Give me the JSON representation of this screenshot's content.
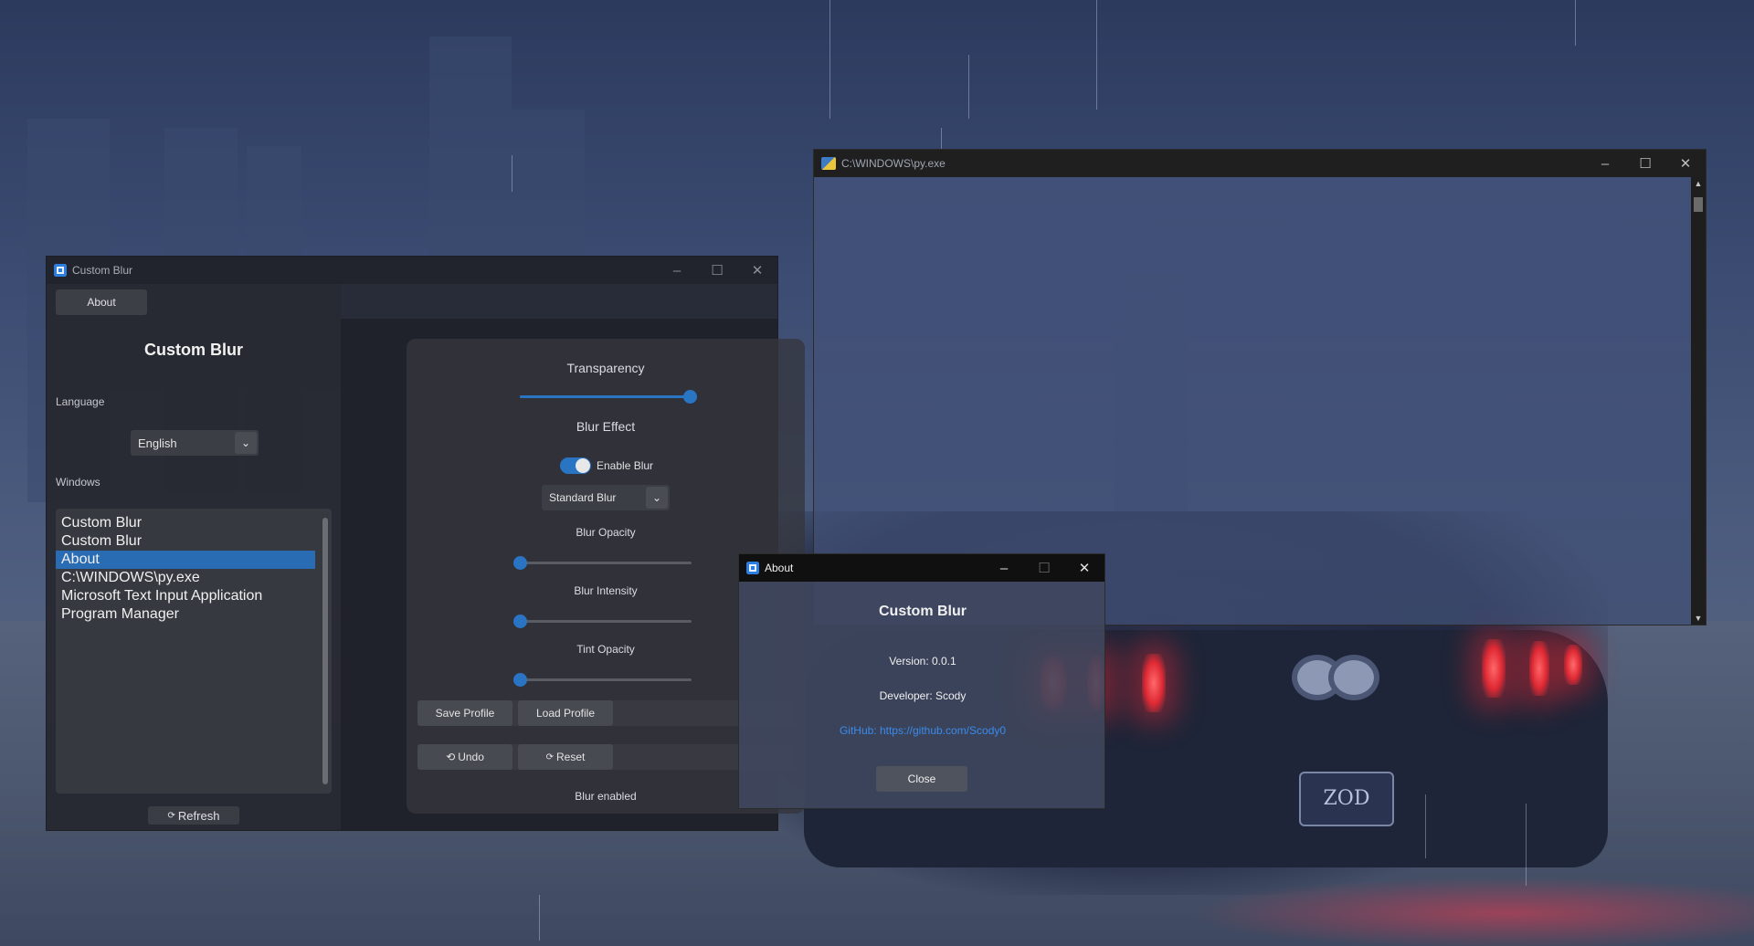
{
  "custom_blur_window": {
    "title": "Custom Blur",
    "about_button": "About",
    "heading": "Custom Blur",
    "language_label": "Language",
    "language_value": "English",
    "windows_label": "Windows",
    "windows_list": [
      "Custom Blur",
      "Custom Blur",
      "About",
      "C:\\WINDOWS\\py.exe",
      "Microsoft Text Input Application",
      "Program Manager"
    ],
    "selected_window_index": 2,
    "refresh_button": "Refresh",
    "transparency_label": "Transparency",
    "transparency_value": 1.0,
    "blur_effect_label": "Blur Effect",
    "enable_blur_label": "Enable Blur",
    "enable_blur_on": true,
    "blur_type": "Standard Blur",
    "blur_opacity_label": "Blur Opacity",
    "blur_opacity_value": 0.0,
    "blur_intensity_label": "Blur Intensity",
    "blur_intensity_value": 0.0,
    "tint_opacity_label": "Tint Opacity",
    "tint_opacity_value": 0.0,
    "save_profile": "Save Profile",
    "load_profile": "Load Profile",
    "undo": "Undo",
    "reset": "Reset",
    "status": "Blur enabled"
  },
  "py_window": {
    "title": "C:\\WINDOWS\\py.exe"
  },
  "about_dialog": {
    "title": "About",
    "heading": "Custom Blur",
    "version": "Version: 0.0.1",
    "developer": "Developer: Scody",
    "github_prefix": "GitHub: ",
    "github_url": "https://github.com/Scody0",
    "close_button": "Close"
  },
  "wallpaper": {
    "plate_text": "ZOD"
  },
  "colors": {
    "accent": "#2a74c4",
    "link": "#3a8bea",
    "selection": "#2a6cb4"
  }
}
